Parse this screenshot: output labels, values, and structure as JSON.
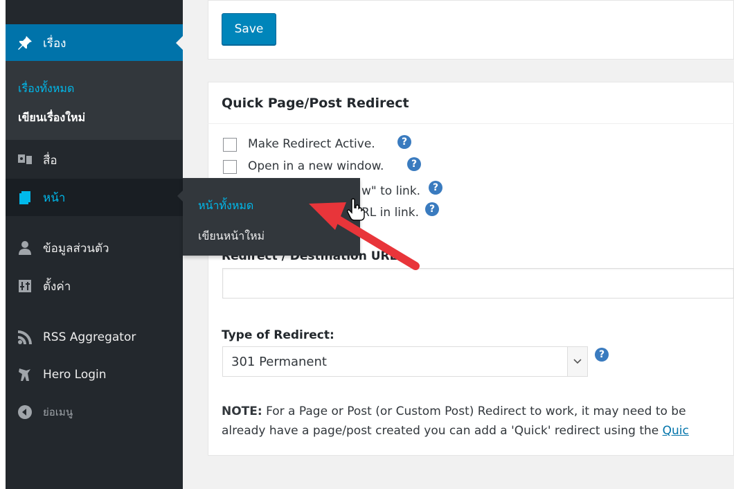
{
  "sidebar": {
    "items": [
      {
        "label": "เรื่อง",
        "icon": "pin-icon"
      },
      {
        "label": "สื่อ",
        "icon": "media-icon"
      },
      {
        "label": "หน้า",
        "icon": "pages-icon"
      },
      {
        "label": "ข้อมูลส่วนตัว",
        "icon": "user-icon"
      },
      {
        "label": "ตั้งค่า",
        "icon": "settings-icon"
      },
      {
        "label": "RSS Aggregator",
        "icon": "rss-icon"
      },
      {
        "label": "Hero Login",
        "icon": "hero-icon"
      },
      {
        "label": "ย่อเมนู",
        "icon": "collapse-icon"
      }
    ],
    "posts_submenu": [
      "เรื่องทั้งหมด",
      "เขียนเรื่องใหม่"
    ],
    "pages_flyout": [
      "หน้าทั้งหมด",
      "เขียนหน้าใหม่"
    ]
  },
  "save_button": "Save",
  "redirect_box": {
    "title": "Quick Page/Post Redirect",
    "options": [
      "Make Redirect Active.",
      "Open in a new window.",
      "w\" to link.",
      "RL in link."
    ],
    "destination_label": "Redirect / Destination URL",
    "type_label": "Type of Redirect:",
    "type_value": "301 Permanent",
    "note_bold": "NOTE:",
    "note_line1": "For a Page or Post (or Custom Post) Redirect to work, it may need to be",
    "note_line2": "already have a page/post created you can add a 'Quick' redirect using the",
    "note_link": "Quic",
    "help_glyph": "?"
  },
  "colors": {
    "sidebar_bg": "#23282d",
    "submenu_bg": "#32373c",
    "current_bg": "#0073aa",
    "accent_text": "#00b9eb",
    "button_bg": "#0085ba",
    "arrow": "#e8353a"
  }
}
